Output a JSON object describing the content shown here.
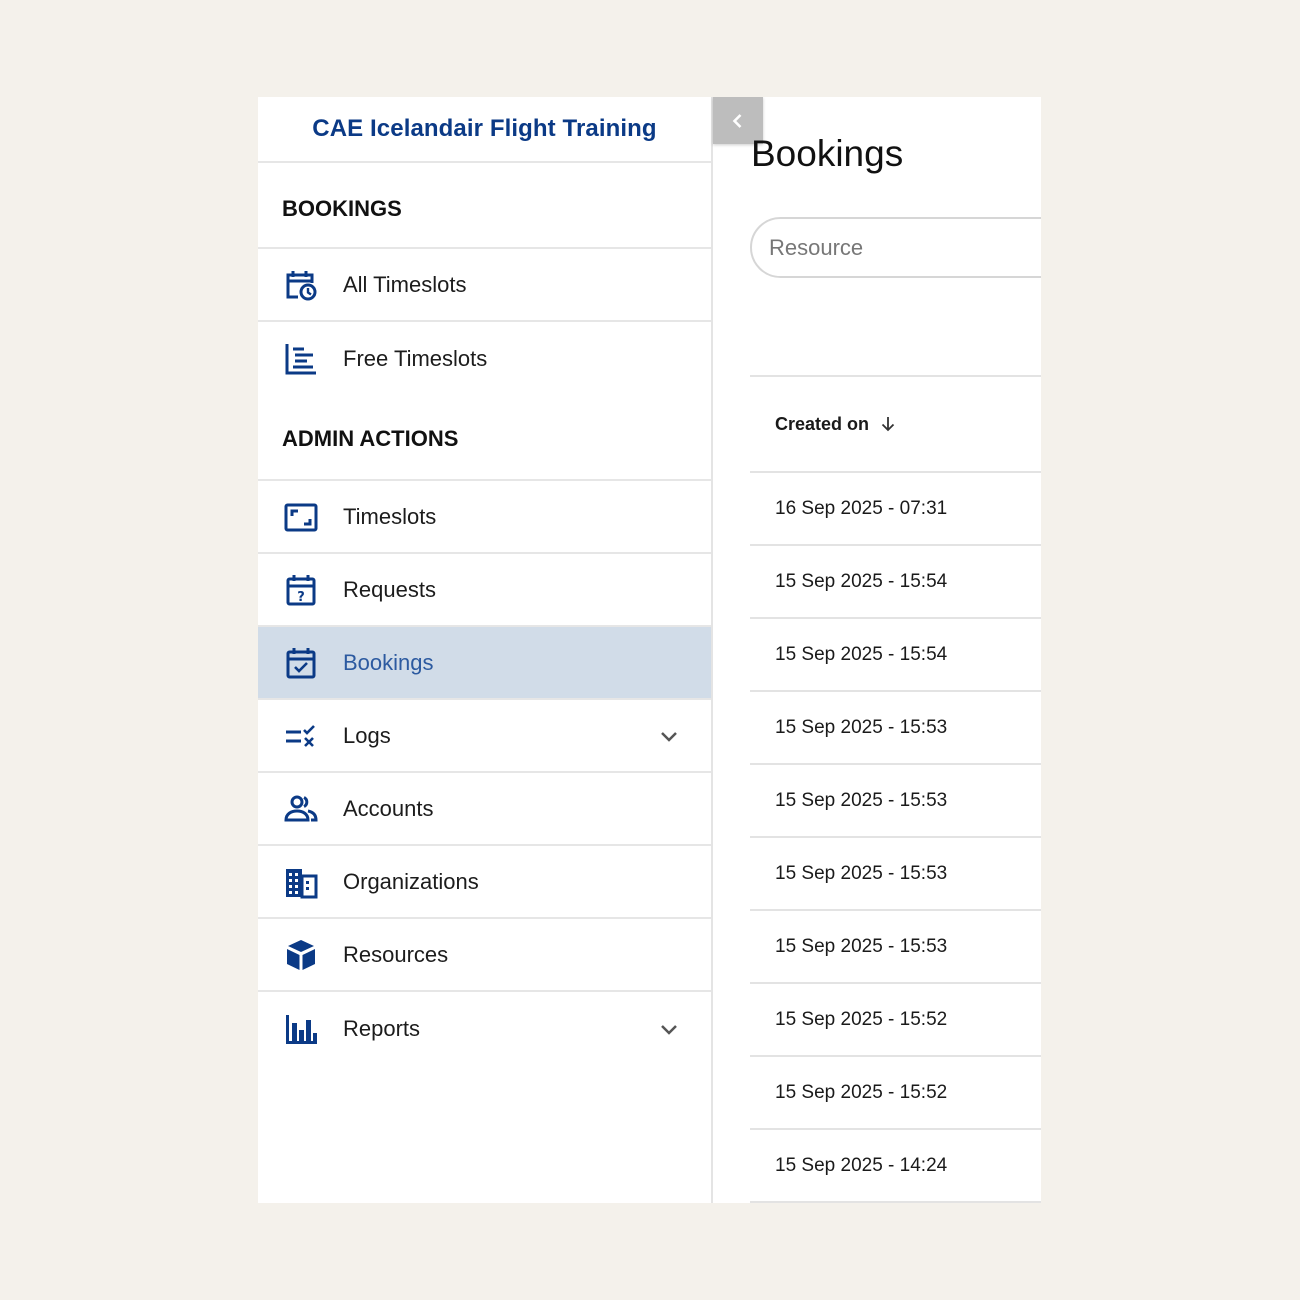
{
  "brand": {
    "title": "CAE Icelandair Flight Training"
  },
  "sidebar": {
    "sections": [
      {
        "title": "BOOKINGS"
      },
      {
        "title": "ADMIN ACTIONS"
      }
    ],
    "items": [
      {
        "label": "All Timeslots",
        "icon": "calendar-clock-icon"
      },
      {
        "label": "Free Timeslots",
        "icon": "timeline-icon"
      },
      {
        "label": "Timeslots",
        "icon": "fullscreen-frame-icon"
      },
      {
        "label": "Requests",
        "icon": "calendar-question-icon"
      },
      {
        "label": "Bookings",
        "icon": "calendar-check-icon",
        "active": true
      },
      {
        "label": "Logs",
        "icon": "checklist-icon",
        "expandable": true
      },
      {
        "label": "Accounts",
        "icon": "people-icon"
      },
      {
        "label": "Organizations",
        "icon": "building-icon"
      },
      {
        "label": "Resources",
        "icon": "cube-icon"
      },
      {
        "label": "Reports",
        "icon": "bar-chart-icon",
        "expandable": true
      }
    ]
  },
  "main": {
    "title": "Bookings",
    "search": {
      "placeholder": "Resource",
      "value": ""
    },
    "table": {
      "columns": [
        {
          "label": "Created on",
          "sort": "descending"
        }
      ],
      "rows": [
        "16 Sep 2025 - 07:31",
        "15 Sep 2025 - 15:54",
        "15 Sep 2025 - 15:54",
        "15 Sep 2025 - 15:53",
        "15 Sep 2025 - 15:53",
        "15 Sep 2025 - 15:53",
        "15 Sep 2025 - 15:53",
        "15 Sep 2025 - 15:52",
        "15 Sep 2025 - 15:52",
        "15 Sep 2025 - 14:24"
      ]
    }
  },
  "colors": {
    "brand": "#0b3a86",
    "icon": "#0b3a86",
    "active_bg": "#d1dce8",
    "active_text": "#2c5aa0"
  }
}
